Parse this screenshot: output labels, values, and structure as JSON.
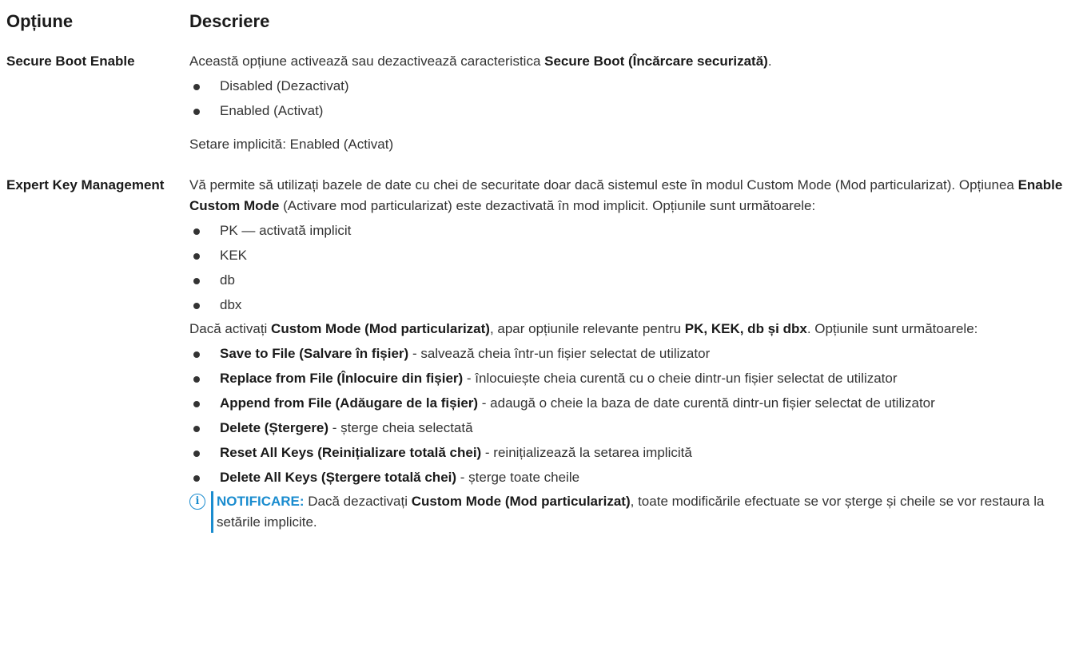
{
  "header": {
    "option_label": "Opțiune",
    "description_label": "Descriere"
  },
  "rows": [
    {
      "option": "Secure Boot Enable",
      "intro_prefix": "Această opțiune activează sau dezactivează caracteristica ",
      "intro_bold": "Secure Boot (Încărcare securizată)",
      "intro_suffix": ".",
      "items": [
        "Disabled (Dezactivat)",
        "Enabled (Activat)"
      ],
      "default": "Setare implicită: Enabled (Activat)"
    },
    {
      "option": "Expert Key Management",
      "p1_a": "Vă permite să utilizați bazele de date cu chei de securitate doar dacă sistemul este în modul Custom Mode (Mod particularizat). Opțiunea ",
      "p1_bold": "Enable Custom Mode",
      "p1_b": " (Activare mod particularizat) este dezactivată în mod implicit. Opțiunile sunt următoarele:",
      "items1": [
        "PK — activată implicit",
        "KEK",
        "db",
        "dbx"
      ],
      "p2_a": "Dacă activați ",
      "p2_bold1": "Custom Mode (Mod particularizat)",
      "p2_b": ", apar opțiunile relevante pentru ",
      "p2_bold2": "PK, KEK, db și dbx",
      "p2_c": ". Opțiunile sunt următoarele:",
      "items2": [
        {
          "bold": "Save to File (Salvare în fișier)",
          "text": " - salvează cheia într-un fișier selectat de utilizator"
        },
        {
          "bold": "Replace from File (Înlocuire din fișier)",
          "text": " - înlocuiește cheia curentă cu o cheie dintr-un fișier selectat de utilizator"
        },
        {
          "bold": "Append from File (Adăugare de la fișier)",
          "text": " - adaugă o cheie la baza de date curentă dintr-un fișier selectat de utilizator"
        },
        {
          "bold": "Delete (Ștergere)",
          "text": " - șterge cheia selectată"
        },
        {
          "bold": "Reset All Keys (Reinițializare totală chei)",
          "text": " - reinițializează la setarea implicită"
        },
        {
          "bold": "Delete All Keys (Ștergere totală chei)",
          "text": " - șterge toate cheile"
        }
      ],
      "note": {
        "icon": "info-icon",
        "label": "NOTIFICARE:",
        "text_a": " Dacă dezactivați ",
        "bold": "Custom Mode (Mod particularizat)",
        "text_b": ", toate modificările efectuate se vor șterge și cheile se vor restaura la setările implicite."
      }
    }
  ],
  "colors": {
    "text": "#333333",
    "heading": "#1a1a1a",
    "note_accent": "#1a8ccf"
  }
}
